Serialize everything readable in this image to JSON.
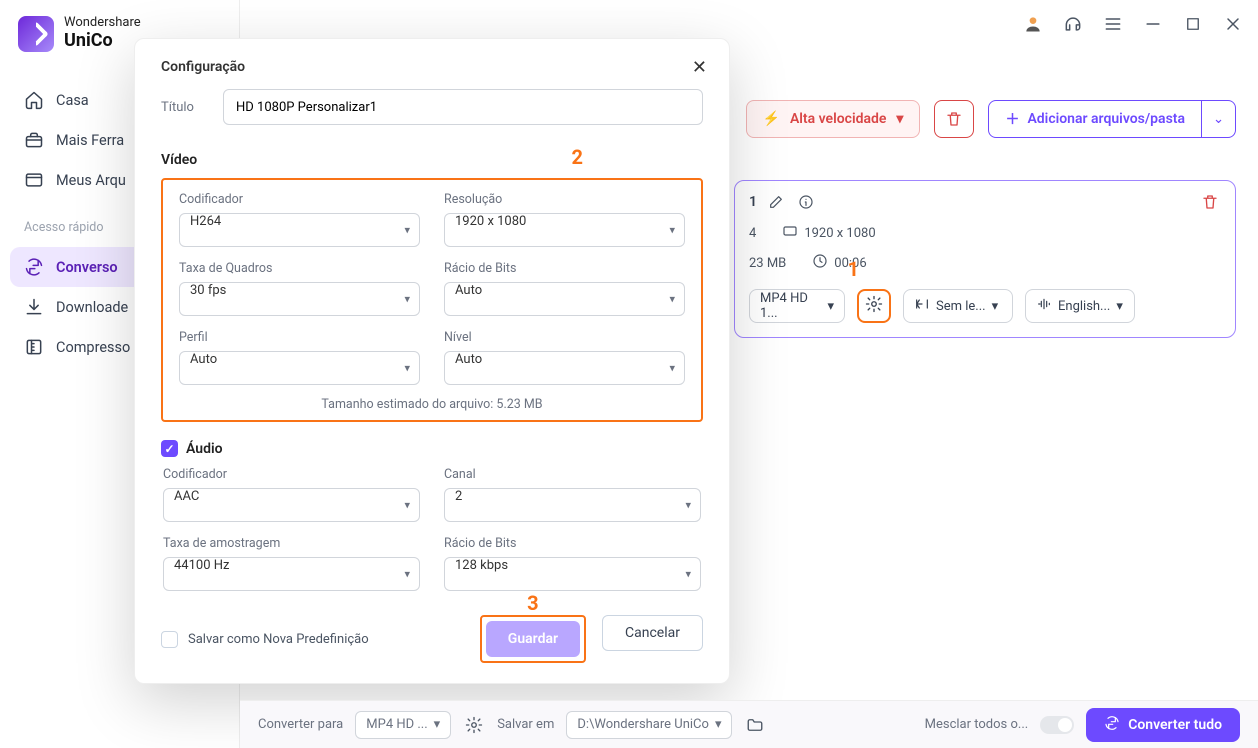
{
  "app": {
    "brand_top": "Wondershare",
    "brand_main": "UniCo"
  },
  "sidebar": {
    "items": [
      {
        "label": "Casa",
        "icon": "home"
      },
      {
        "label": "Mais Ferra",
        "icon": "toolbox"
      },
      {
        "label": "Meus Arqu",
        "icon": "file"
      }
    ],
    "section_label": "Acesso rápido",
    "quick": [
      {
        "label": "Converso",
        "icon": "convert",
        "active": true
      },
      {
        "label": "Downloade",
        "icon": "download"
      },
      {
        "label": "Compresso",
        "icon": "compress"
      }
    ]
  },
  "toolbar": {
    "speed_label": "Alta velocidade",
    "add_label": "Adicionar arquivos/pasta"
  },
  "file": {
    "name_suffix": "1",
    "format": "4",
    "size": "23 MB",
    "resolution": "1920 x 1080",
    "duration": "00:06",
    "convert_to": "MP4 HD 1...",
    "subtitle_label": "Sem le...",
    "audio_label": "English..."
  },
  "annotations": {
    "n1": "1",
    "n2": "2",
    "n3": "3"
  },
  "modal": {
    "title": "Configuração",
    "titulo_label": "Título",
    "titulo_value": "HD 1080P Personalizar1",
    "video_label": "Vídeo",
    "fields": {
      "encoder_label": "Codificador",
      "encoder_value": "H264",
      "resolution_label": "Resolução",
      "resolution_value": "1920 x 1080",
      "fps_label": "Taxa de Quadros",
      "fps_value": "30 fps",
      "bitrate_label": "Rácio de Bits",
      "bitrate_value": "Auto",
      "profile_label": "Perfil",
      "profile_value": "Auto",
      "level_label": "Nível",
      "level_value": "Auto"
    },
    "estimated": "Tamanho estimado do arquivo: 5.23 MB",
    "audio_label": "Áudio",
    "audio": {
      "encoder_label": "Codificador",
      "encoder_value": "AAC",
      "channel_label": "Canal",
      "channel_value": "2",
      "sample_label": "Taxa de amostragem",
      "sample_value": "44100 Hz",
      "bitrate_label": "Rácio de Bits",
      "bitrate_value": "128 kbps"
    },
    "save_preset_label": "Salvar como Nova Predefinição",
    "save_btn": "Guardar",
    "cancel_btn": "Cancelar"
  },
  "bottom": {
    "convert_to_label": "Converter para",
    "convert_to_value": "MP4 HD ...",
    "save_to_label": "Salvar em",
    "save_to_value": "D:\\Wondershare UniCo",
    "merge_label": "Mesclar todos o...",
    "convert_all": "Converter tudo"
  }
}
